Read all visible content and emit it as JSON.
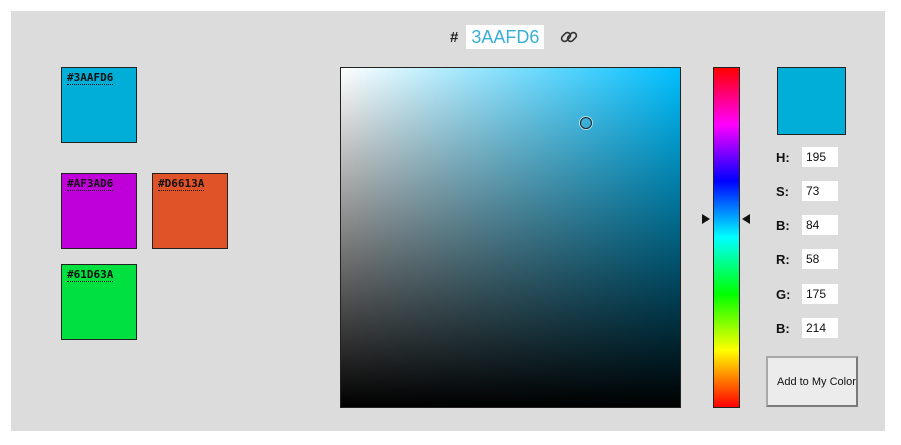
{
  "header": {
    "hash": "#",
    "hex_value": "3AAFD6",
    "link_icon": "link-icon"
  },
  "swatches": [
    {
      "label": "#3AAFD6",
      "color": "#00aed8"
    },
    {
      "label": "#AF3AD6",
      "color": "#c000d8"
    },
    {
      "label": "#D6613A",
      "color": "#e05228"
    },
    {
      "label": "#61D63A",
      "color": "#00e040"
    }
  ],
  "picker": {
    "hue_deg": 195,
    "saturation": 73,
    "brightness": 84
  },
  "preview_color": "#00aed8",
  "fields": [
    {
      "label": "H:",
      "value": "195"
    },
    {
      "label": "S:",
      "value": "73"
    },
    {
      "label": "B:",
      "value": "84"
    },
    {
      "label": "R:",
      "value": "58"
    },
    {
      "label": "G:",
      "value": "175"
    },
    {
      "label": "B:",
      "value": "214"
    }
  ],
  "add_button": "Add to My Colors"
}
